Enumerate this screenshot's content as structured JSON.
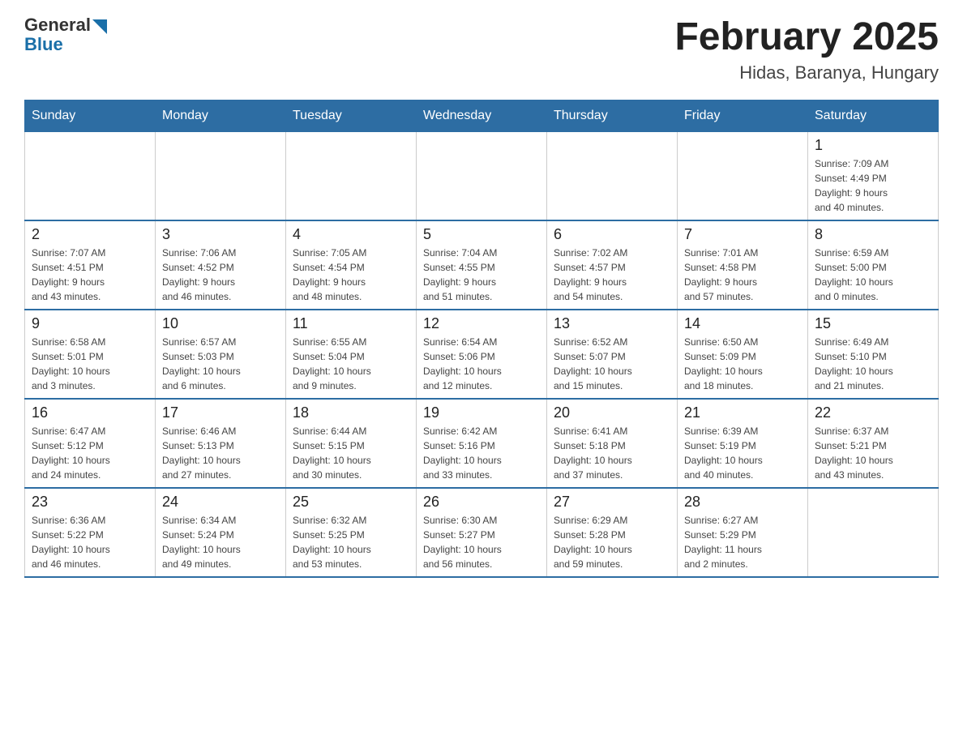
{
  "header": {
    "logo_general": "General",
    "logo_blue": "Blue",
    "title": "February 2025",
    "subtitle": "Hidas, Baranya, Hungary"
  },
  "days_of_week": [
    "Sunday",
    "Monday",
    "Tuesday",
    "Wednesday",
    "Thursday",
    "Friday",
    "Saturday"
  ],
  "weeks": [
    [
      {
        "day": "",
        "info": ""
      },
      {
        "day": "",
        "info": ""
      },
      {
        "day": "",
        "info": ""
      },
      {
        "day": "",
        "info": ""
      },
      {
        "day": "",
        "info": ""
      },
      {
        "day": "",
        "info": ""
      },
      {
        "day": "1",
        "info": "Sunrise: 7:09 AM\nSunset: 4:49 PM\nDaylight: 9 hours\nand 40 minutes."
      }
    ],
    [
      {
        "day": "2",
        "info": "Sunrise: 7:07 AM\nSunset: 4:51 PM\nDaylight: 9 hours\nand 43 minutes."
      },
      {
        "day": "3",
        "info": "Sunrise: 7:06 AM\nSunset: 4:52 PM\nDaylight: 9 hours\nand 46 minutes."
      },
      {
        "day": "4",
        "info": "Sunrise: 7:05 AM\nSunset: 4:54 PM\nDaylight: 9 hours\nand 48 minutes."
      },
      {
        "day": "5",
        "info": "Sunrise: 7:04 AM\nSunset: 4:55 PM\nDaylight: 9 hours\nand 51 minutes."
      },
      {
        "day": "6",
        "info": "Sunrise: 7:02 AM\nSunset: 4:57 PM\nDaylight: 9 hours\nand 54 minutes."
      },
      {
        "day": "7",
        "info": "Sunrise: 7:01 AM\nSunset: 4:58 PM\nDaylight: 9 hours\nand 57 minutes."
      },
      {
        "day": "8",
        "info": "Sunrise: 6:59 AM\nSunset: 5:00 PM\nDaylight: 10 hours\nand 0 minutes."
      }
    ],
    [
      {
        "day": "9",
        "info": "Sunrise: 6:58 AM\nSunset: 5:01 PM\nDaylight: 10 hours\nand 3 minutes."
      },
      {
        "day": "10",
        "info": "Sunrise: 6:57 AM\nSunset: 5:03 PM\nDaylight: 10 hours\nand 6 minutes."
      },
      {
        "day": "11",
        "info": "Sunrise: 6:55 AM\nSunset: 5:04 PM\nDaylight: 10 hours\nand 9 minutes."
      },
      {
        "day": "12",
        "info": "Sunrise: 6:54 AM\nSunset: 5:06 PM\nDaylight: 10 hours\nand 12 minutes."
      },
      {
        "day": "13",
        "info": "Sunrise: 6:52 AM\nSunset: 5:07 PM\nDaylight: 10 hours\nand 15 minutes."
      },
      {
        "day": "14",
        "info": "Sunrise: 6:50 AM\nSunset: 5:09 PM\nDaylight: 10 hours\nand 18 minutes."
      },
      {
        "day": "15",
        "info": "Sunrise: 6:49 AM\nSunset: 5:10 PM\nDaylight: 10 hours\nand 21 minutes."
      }
    ],
    [
      {
        "day": "16",
        "info": "Sunrise: 6:47 AM\nSunset: 5:12 PM\nDaylight: 10 hours\nand 24 minutes."
      },
      {
        "day": "17",
        "info": "Sunrise: 6:46 AM\nSunset: 5:13 PM\nDaylight: 10 hours\nand 27 minutes."
      },
      {
        "day": "18",
        "info": "Sunrise: 6:44 AM\nSunset: 5:15 PM\nDaylight: 10 hours\nand 30 minutes."
      },
      {
        "day": "19",
        "info": "Sunrise: 6:42 AM\nSunset: 5:16 PM\nDaylight: 10 hours\nand 33 minutes."
      },
      {
        "day": "20",
        "info": "Sunrise: 6:41 AM\nSunset: 5:18 PM\nDaylight: 10 hours\nand 37 minutes."
      },
      {
        "day": "21",
        "info": "Sunrise: 6:39 AM\nSunset: 5:19 PM\nDaylight: 10 hours\nand 40 minutes."
      },
      {
        "day": "22",
        "info": "Sunrise: 6:37 AM\nSunset: 5:21 PM\nDaylight: 10 hours\nand 43 minutes."
      }
    ],
    [
      {
        "day": "23",
        "info": "Sunrise: 6:36 AM\nSunset: 5:22 PM\nDaylight: 10 hours\nand 46 minutes."
      },
      {
        "day": "24",
        "info": "Sunrise: 6:34 AM\nSunset: 5:24 PM\nDaylight: 10 hours\nand 49 minutes."
      },
      {
        "day": "25",
        "info": "Sunrise: 6:32 AM\nSunset: 5:25 PM\nDaylight: 10 hours\nand 53 minutes."
      },
      {
        "day": "26",
        "info": "Sunrise: 6:30 AM\nSunset: 5:27 PM\nDaylight: 10 hours\nand 56 minutes."
      },
      {
        "day": "27",
        "info": "Sunrise: 6:29 AM\nSunset: 5:28 PM\nDaylight: 10 hours\nand 59 minutes."
      },
      {
        "day": "28",
        "info": "Sunrise: 6:27 AM\nSunset: 5:29 PM\nDaylight: 11 hours\nand 2 minutes."
      },
      {
        "day": "",
        "info": ""
      }
    ]
  ]
}
